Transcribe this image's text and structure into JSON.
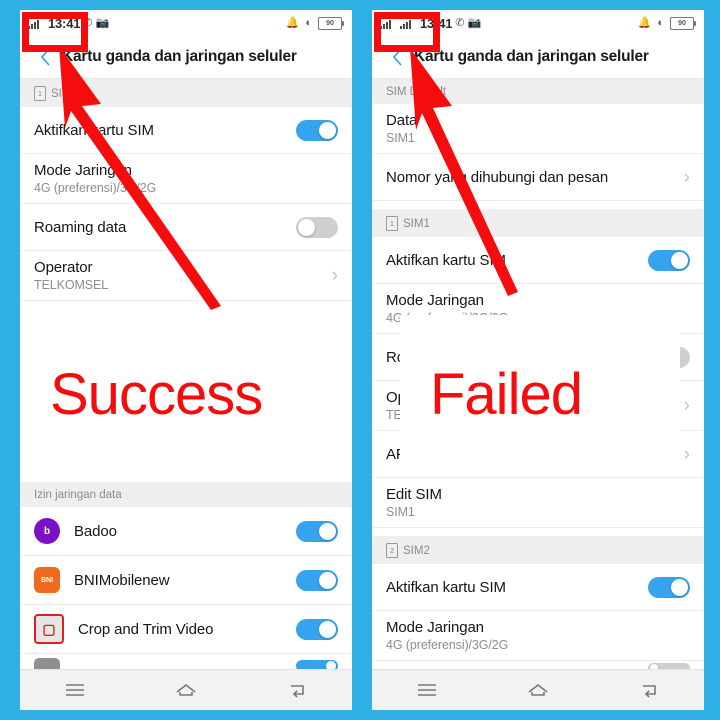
{
  "background_color": "#2eb0e5",
  "accent_color": "#36a3ee",
  "annotation_color": "#f60c0c",
  "annotations": {
    "success_label": "Success",
    "failed_label": "Failed",
    "left_highlight_name": "single-signal-indicator-highlight",
    "right_highlight_name": "dual-signal-indicator-highlight"
  },
  "left_phone": {
    "status_bar": {
      "signals": [
        {
          "generation": "3G"
        }
      ],
      "time": "13:41",
      "icons": [
        "whatsapp-icon",
        "screenshot-icon",
        "alarm-icon"
      ],
      "bell_muted_icon": "bell-muted-icon",
      "wifi_icon": "wifi-icon",
      "battery_level": "90"
    },
    "app_bar": {
      "back": "‹",
      "title": "Kartu ganda dan jaringan seluler"
    },
    "sections": [
      {
        "header": "SIM1",
        "sim_number": "1",
        "rows": [
          {
            "title": "Aktifkan kartu SIM",
            "sub": "",
            "control": "toggle",
            "state": "on"
          },
          {
            "title": "Mode Jaringan",
            "sub": "4G (preferensi)/3G/2G",
            "control": "none",
            "state": ""
          },
          {
            "title": "Roaming data",
            "sub": "",
            "control": "toggle",
            "state": "off"
          },
          {
            "title": "Operator",
            "sub": "TELKOMSEL",
            "control": "chevron",
            "state": ""
          }
        ]
      },
      {
        "header": "Izin jaringan data",
        "sim_number": "",
        "apps": [
          {
            "name": "Badoo",
            "icon_color": "#7a11c7",
            "icon_text": "b",
            "state": "on"
          },
          {
            "name": "BNIMobilenew",
            "icon_color": "#ef6a1e",
            "icon_text": "BNI",
            "state": "on"
          },
          {
            "name": "Crop and Trim Video",
            "icon_color": "#e02020",
            "icon_text": "▢",
            "state": "on"
          },
          {
            "name": "",
            "icon_color": "#8a8a8a",
            "icon_text": "",
            "state": "on"
          }
        ]
      }
    ],
    "nav_bar": {
      "menu": "menu-icon",
      "home": "home-icon",
      "back": "back-icon"
    }
  },
  "right_phone": {
    "status_bar": {
      "signals": [
        {
          "generation": "3G"
        },
        {
          "generation": "4G"
        }
      ],
      "time": "13:41",
      "icons": [
        "whatsapp-icon",
        "screenshot-icon",
        "alarm-icon"
      ],
      "bell_muted_icon": "bell-muted-icon",
      "wifi_icon": "wifi-icon",
      "battery_level": "90"
    },
    "app_bar": {
      "back": "‹",
      "title": "Kartu ganda dan jaringan seluler"
    },
    "sections": [
      {
        "header": "SIM Default",
        "sim_number": "",
        "rows": [
          {
            "title": "Data",
            "sub": "SIM1",
            "control": "none",
            "state": ""
          },
          {
            "title": "Nomor yang dihubungi dan pesan",
            "sub": "",
            "control": "chevron",
            "state": ""
          }
        ]
      },
      {
        "header": "SIM1",
        "sim_number": "1",
        "rows": [
          {
            "title": "Aktifkan kartu SIM",
            "sub": "",
            "control": "toggle",
            "state": "on"
          },
          {
            "title": "Mode Jaringan",
            "sub": "4G (preferensi)/3G/2G",
            "control": "none",
            "state": ""
          },
          {
            "title": "Roaming data",
            "sub": "",
            "control": "toggle",
            "state": "off"
          },
          {
            "title": "Operator",
            "sub": "TELKOMSEL",
            "control": "chevron",
            "state": ""
          },
          {
            "title": "APN",
            "sub": "",
            "control": "chevron",
            "state": ""
          },
          {
            "title": "Edit SIM",
            "sub": "SIM1",
            "control": "none",
            "state": ""
          }
        ]
      },
      {
        "header": "SIM2",
        "sim_number": "2",
        "rows": [
          {
            "title": "Aktifkan kartu SIM",
            "sub": "",
            "control": "toggle",
            "state": "on"
          },
          {
            "title": "Mode Jaringan",
            "sub": "4G (preferensi)/3G/2G",
            "control": "none",
            "state": ""
          }
        ]
      }
    ],
    "nav_bar": {
      "menu": "menu-icon",
      "home": "home-icon",
      "back": "back-icon"
    }
  }
}
